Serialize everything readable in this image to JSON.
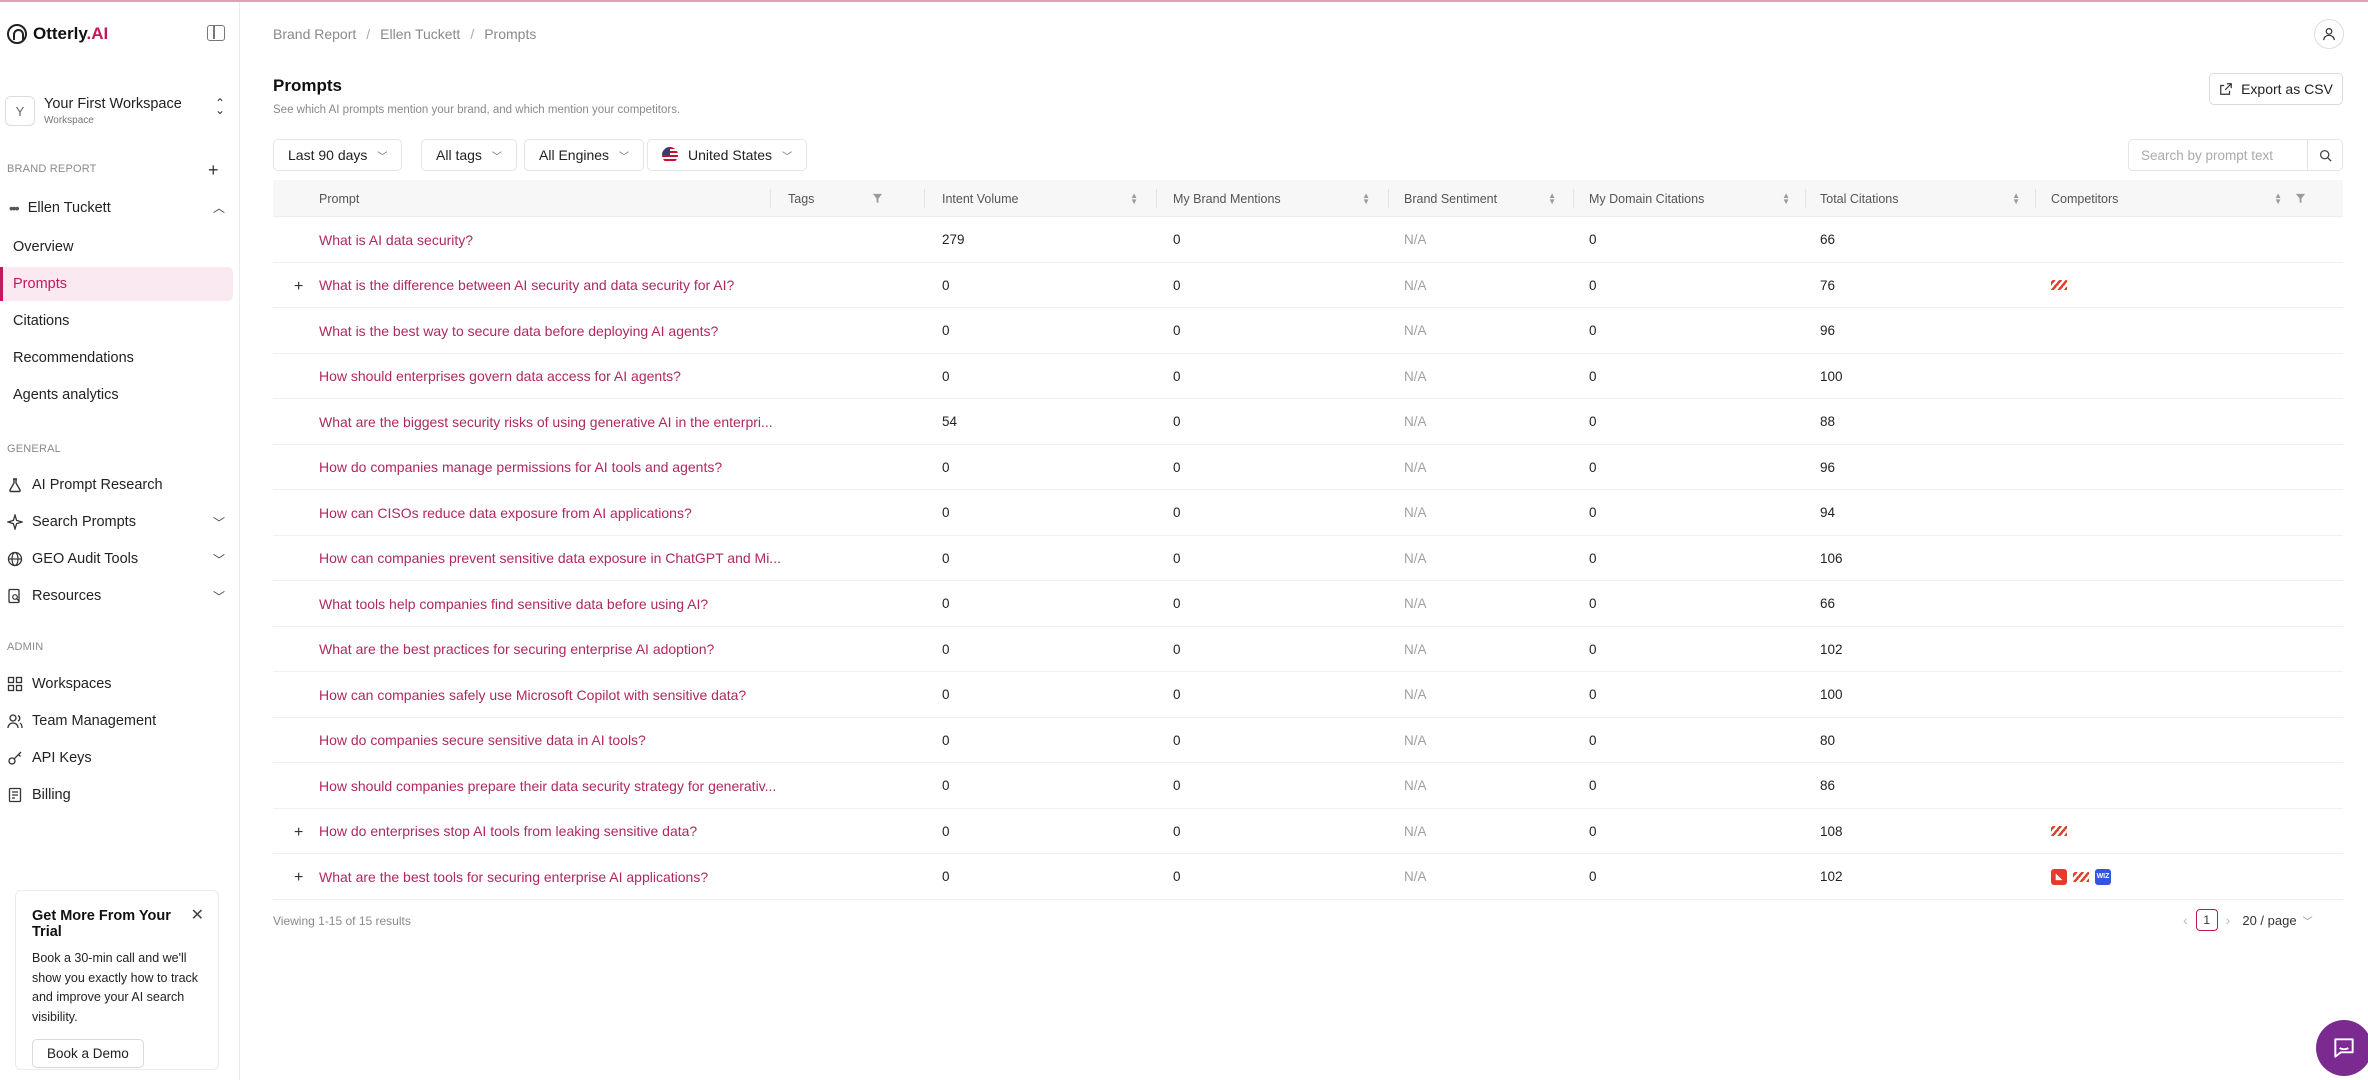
{
  "app": {
    "logo_text": "Otterly",
    "logo_ai": ".AI"
  },
  "workspace": {
    "initial": "Y",
    "name": "Your First Workspace",
    "sub": "Workspace"
  },
  "sidebar": {
    "brand_report_label": "BRAND REPORT",
    "brand_name": "Ellen Tuckett",
    "brand_items": [
      {
        "label": "Overview"
      },
      {
        "label": "Prompts"
      },
      {
        "label": "Citations"
      },
      {
        "label": "Recommendations"
      },
      {
        "label": "Agents analytics"
      }
    ],
    "general_label": "GENERAL",
    "general_items": [
      {
        "label": "AI Prompt Research",
        "icon": "flask-icon"
      },
      {
        "label": "Search Prompts",
        "icon": "sparkle-icon"
      },
      {
        "label": "GEO Audit Tools",
        "icon": "globe-icon"
      },
      {
        "label": "Resources",
        "icon": "document-search-icon"
      }
    ],
    "admin_label": "ADMIN",
    "admin_items": [
      {
        "label": "Workspaces",
        "icon": "grid-icon"
      },
      {
        "label": "Team Management",
        "icon": "users-icon"
      },
      {
        "label": "API Keys",
        "icon": "key-icon"
      },
      {
        "label": "Billing",
        "icon": "billing-icon"
      }
    ],
    "trial": {
      "title": "Get More From Your Trial",
      "body": "Book a 30-min call and we'll show you exactly how to track and improve your AI search visibility.",
      "button": "Book a Demo"
    }
  },
  "breadcrumb": [
    "Brand Report",
    "Ellen Tuckett",
    "Prompts"
  ],
  "page": {
    "title": "Prompts",
    "subtitle": "See which AI prompts mention your brand, and which mention your competitors.",
    "export_label": "Export as CSV"
  },
  "filters": {
    "period": "Last 90 days",
    "tags": "All tags",
    "engines": "All Engines",
    "country": "United States",
    "search_placeholder": "Search by prompt text"
  },
  "table": {
    "headers": {
      "prompt": "Prompt",
      "tags": "Tags",
      "intent": "Intent Volume",
      "mentions": "My Brand Mentions",
      "sentiment": "Brand Sentiment",
      "domain": "My Domain Citations",
      "total": "Total Citations",
      "competitors": "Competitors"
    },
    "rows": [
      {
        "expand": "",
        "prompt": "What is AI data security?",
        "intent": "279",
        "mentions": "0",
        "sentiment": "N/A",
        "domain": "0",
        "total": "66",
        "competitors": []
      },
      {
        "expand": "+",
        "prompt": "What is the difference between AI security and data security for AI?",
        "intent": "0",
        "mentions": "0",
        "sentiment": "N/A",
        "domain": "0",
        "total": "76",
        "competitors": [
          "stripe"
        ]
      },
      {
        "expand": "",
        "prompt": "What is the best way to secure data before deploying AI agents?",
        "intent": "0",
        "mentions": "0",
        "sentiment": "N/A",
        "domain": "0",
        "total": "96",
        "competitors": []
      },
      {
        "expand": "",
        "prompt": "How should enterprises govern data access for AI agents?",
        "intent": "0",
        "mentions": "0",
        "sentiment": "N/A",
        "domain": "0",
        "total": "100",
        "competitors": []
      },
      {
        "expand": "",
        "prompt": "What are the biggest security risks of using generative AI in the enterpri...",
        "intent": "54",
        "mentions": "0",
        "sentiment": "N/A",
        "domain": "0",
        "total": "88",
        "competitors": []
      },
      {
        "expand": "",
        "prompt": "How do companies manage permissions for AI tools and agents?",
        "intent": "0",
        "mentions": "0",
        "sentiment": "N/A",
        "domain": "0",
        "total": "96",
        "competitors": []
      },
      {
        "expand": "",
        "prompt": "How can CISOs reduce data exposure from AI applications?",
        "intent": "0",
        "mentions": "0",
        "sentiment": "N/A",
        "domain": "0",
        "total": "94",
        "competitors": []
      },
      {
        "expand": "",
        "prompt": "How can companies prevent sensitive data exposure in ChatGPT and Mi...",
        "intent": "0",
        "mentions": "0",
        "sentiment": "N/A",
        "domain": "0",
        "total": "106",
        "competitors": []
      },
      {
        "expand": "",
        "prompt": "What tools help companies find sensitive data before using AI?",
        "intent": "0",
        "mentions": "0",
        "sentiment": "N/A",
        "domain": "0",
        "total": "66",
        "competitors": []
      },
      {
        "expand": "",
        "prompt": "What are the best practices for securing enterprise AI adoption?",
        "intent": "0",
        "mentions": "0",
        "sentiment": "N/A",
        "domain": "0",
        "total": "102",
        "competitors": []
      },
      {
        "expand": "",
        "prompt": "How can companies safely use Microsoft Copilot with sensitive data?",
        "intent": "0",
        "mentions": "0",
        "sentiment": "N/A",
        "domain": "0",
        "total": "100",
        "competitors": []
      },
      {
        "expand": "",
        "prompt": "How do companies secure sensitive data in AI tools?",
        "intent": "0",
        "mentions": "0",
        "sentiment": "N/A",
        "domain": "0",
        "total": "80",
        "competitors": []
      },
      {
        "expand": "",
        "prompt": "How should companies prepare their data security strategy for generativ...",
        "intent": "0",
        "mentions": "0",
        "sentiment": "N/A",
        "domain": "0",
        "total": "86",
        "competitors": []
      },
      {
        "expand": "+",
        "prompt": "How do enterprises stop AI tools from leaking sensitive data?",
        "intent": "0",
        "mentions": "0",
        "sentiment": "N/A",
        "domain": "0",
        "total": "108",
        "competitors": [
          "stripe"
        ]
      },
      {
        "expand": "+",
        "prompt": "What are the best tools for securing enterprise AI applications?",
        "intent": "0",
        "mentions": "0",
        "sentiment": "N/A",
        "domain": "0",
        "total": "102",
        "competitors": [
          "red",
          "stripe",
          "wiz"
        ]
      }
    ]
  },
  "footer": {
    "viewing": "Viewing 1-15 of 15 results",
    "page": "1",
    "page_size": "20 / page"
  },
  "colors": {
    "accent": "#c2185b",
    "prompt_link": "#b0285f",
    "fab": "#7b2b8f"
  }
}
